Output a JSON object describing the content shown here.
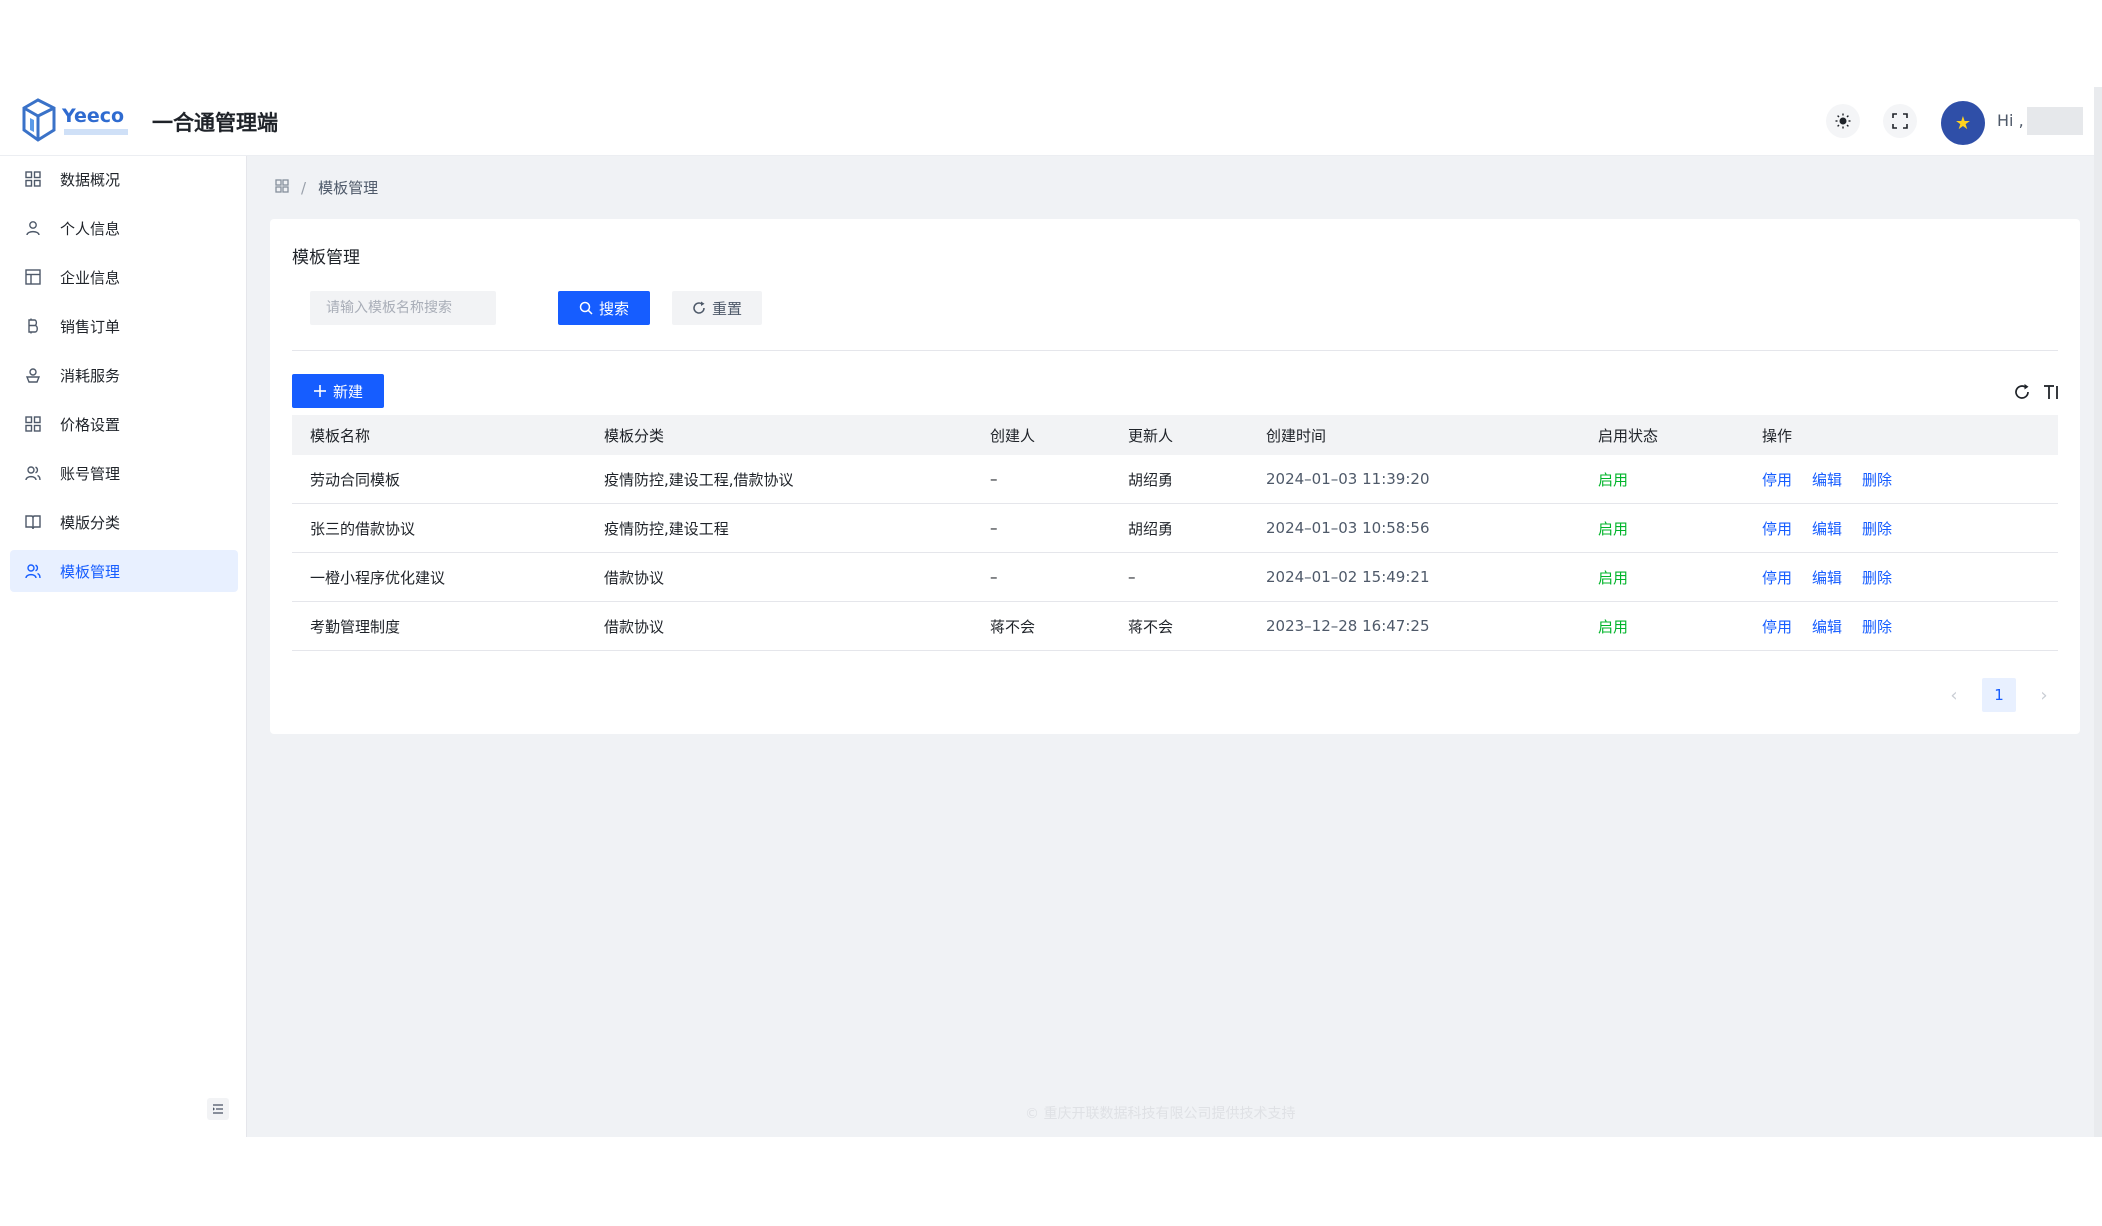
{
  "header": {
    "logo_text": "Yeeco",
    "title": "一合通管理端",
    "greeting": "Hi ,",
    "icons": [
      "theme-toggle-icon",
      "fullscreen-icon"
    ]
  },
  "sidebar": {
    "items": [
      {
        "label": "数据概况",
        "icon": "dashboard-icon"
      },
      {
        "label": "个人信息",
        "icon": "user-icon"
      },
      {
        "label": "企业信息",
        "icon": "building-icon"
      },
      {
        "label": "销售订单",
        "icon": "bitcoin-icon"
      },
      {
        "label": "消耗服务",
        "icon": "service-icon"
      },
      {
        "label": "价格设置",
        "icon": "grid-icon"
      },
      {
        "label": "账号管理",
        "icon": "users-icon"
      },
      {
        "label": "模版分类",
        "icon": "book-icon"
      },
      {
        "label": "模板管理",
        "icon": "users-icon",
        "active": true
      }
    ]
  },
  "breadcrumb": {
    "current": "模板管理"
  },
  "card": {
    "title": "模板管理",
    "search_placeholder": "请输入模板名称搜索",
    "search_label": "搜索",
    "reset_label": "重置",
    "new_label": "新建"
  },
  "table": {
    "columns": [
      "模板名称",
      "模板分类",
      "创建人",
      "更新人",
      "创建时间",
      "启用状态",
      "操作"
    ],
    "rows": [
      {
        "name": "劳动合同模板",
        "category": "疫情防控,建设工程,借款协议",
        "creator": "–",
        "updater": "胡绍勇",
        "created": "2024–01–03 11:39:20",
        "status": "启用"
      },
      {
        "name": "张三的借款协议",
        "category": "疫情防控,建设工程",
        "creator": "–",
        "updater": "胡绍勇",
        "created": "2024–01–03 10:58:56",
        "status": "启用"
      },
      {
        "name": "一橙小程序优化建议",
        "category": "借款协议",
        "creator": "–",
        "updater": "–",
        "created": "2024–01–02 15:49:21",
        "status": "启用"
      },
      {
        "name": "考勤管理制度",
        "category": "借款协议",
        "creator": "蒋不会",
        "updater": "蒋不会",
        "created": "2023–12–28 16:47:25",
        "status": "启用"
      }
    ],
    "actions": [
      "停用",
      "编辑",
      "删除"
    ]
  },
  "pagination": {
    "current_page": "1"
  },
  "footer": "© 重庆开联数据科技有限公司提供技术支持",
  "colors": {
    "primary": "#165dff",
    "success": "#00b42a",
    "background": "#f0f2f5"
  }
}
